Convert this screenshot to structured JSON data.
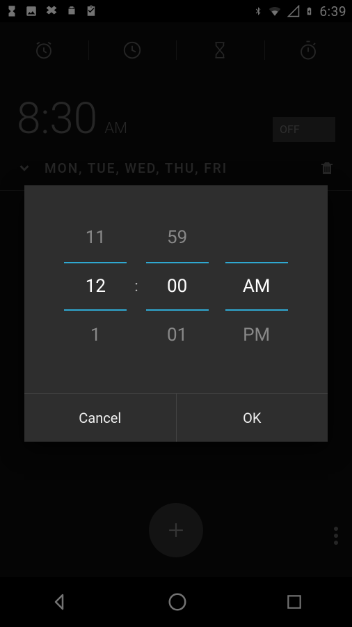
{
  "status": {
    "time": "6:39"
  },
  "alarm": {
    "time": "8:30",
    "ampm": "AM",
    "toggle": "OFF",
    "days": "MON, TUE, WED, THU, FRI"
  },
  "picker": {
    "hour_above": "11",
    "hour_current": "12",
    "hour_below": "1",
    "minute_above": "59",
    "minute_current": "00",
    "minute_below": "01",
    "period_current": "AM",
    "period_below": "PM",
    "separator": ":"
  },
  "dialog": {
    "cancel": "Cancel",
    "ok": "OK"
  }
}
